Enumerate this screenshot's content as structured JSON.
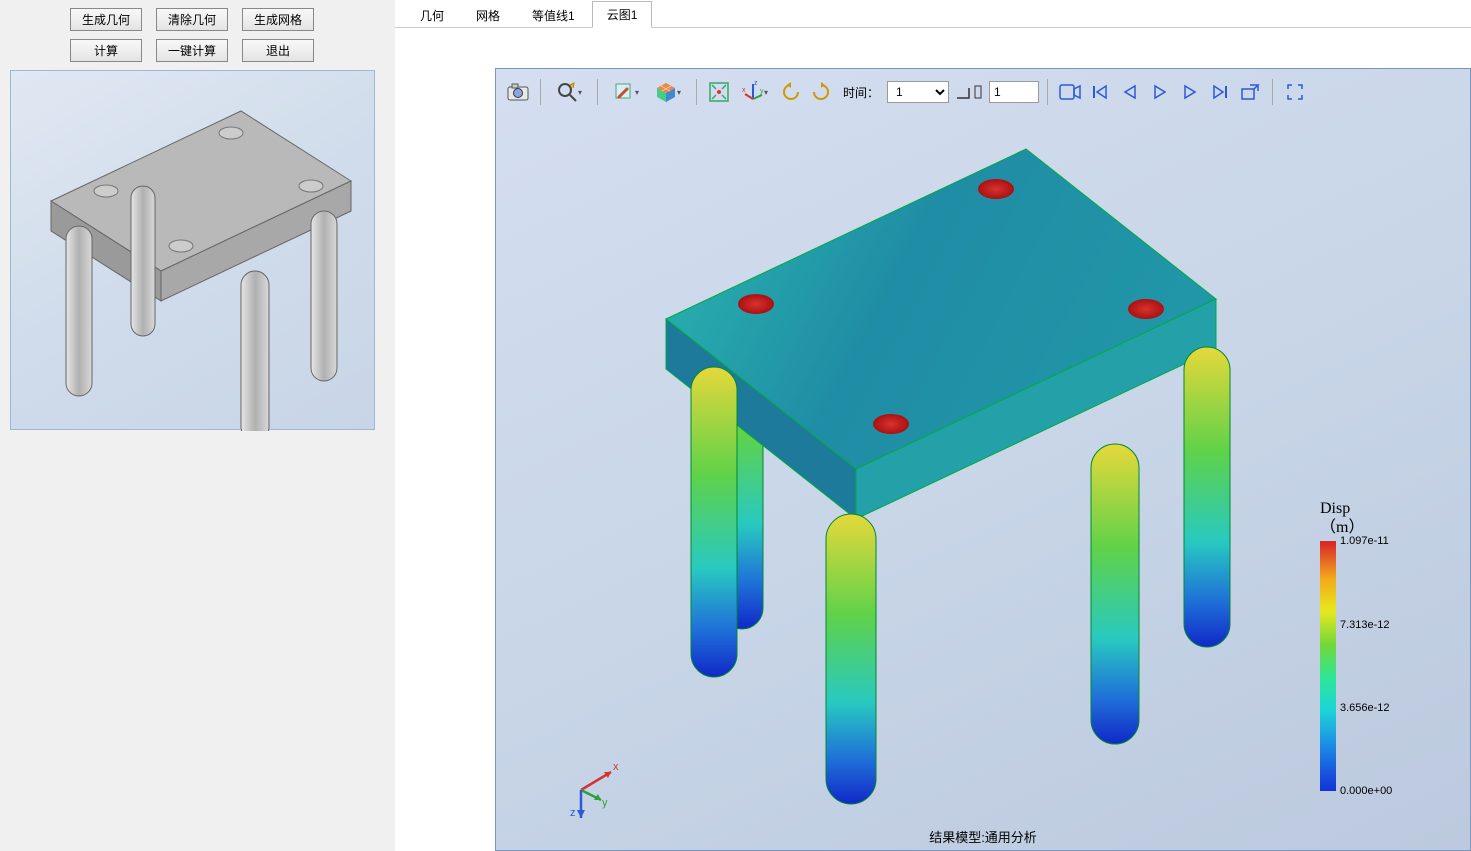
{
  "left": {
    "row1": {
      "b1": "生成几何",
      "b2": "清除几何",
      "b3": "生成网格"
    },
    "row2": {
      "b1": "计算",
      "b2": "一键计算",
      "b3": "退出"
    }
  },
  "tabs": {
    "t1": "几何",
    "t2": "网格",
    "t3": "等值线1",
    "t4": "云图1"
  },
  "toolbar": {
    "time_label": "时间：",
    "time_value": "1",
    "step_value": "1"
  },
  "axis": {
    "x": "x",
    "y": "y",
    "z": "z"
  },
  "legend": {
    "title1": "Disp",
    "title2": "（m）",
    "ticks": [
      {
        "pos": 0,
        "label": "1.097e-11"
      },
      {
        "pos": 33.3,
        "label": "7.313e-12"
      },
      {
        "pos": 66.7,
        "label": "3.656e-12"
      },
      {
        "pos": 100,
        "label": "0.000e+00"
      }
    ]
  },
  "footer": "结果模型:通用分析",
  "icons": {
    "camera": "camera",
    "zoom": "zoom",
    "brush": "brush",
    "cube": "cube",
    "fit": "fit",
    "axes": "axes",
    "reset": "reset",
    "cw": "cw",
    "rec": "rec",
    "first": "first",
    "prev": "prev",
    "play": "play",
    "next": "next",
    "last": "last",
    "export": "export",
    "full": "full"
  }
}
